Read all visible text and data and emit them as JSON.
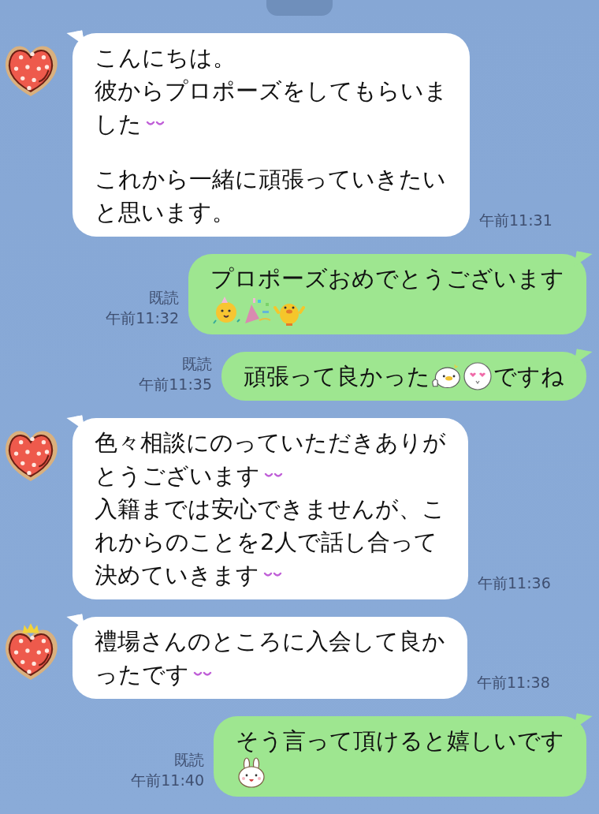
{
  "messages": [
    {
      "kind": "incoming",
      "avatar": {
        "kind": "heart"
      },
      "time": "午前11:31",
      "paragraphs": [
        [
          [
            {
              "kind": "text",
              "text": "こんにちは。"
            }
          ],
          [
            {
              "kind": "text",
              "text": "彼からプロポーズをしてもらいま"
            }
          ],
          [
            {
              "kind": "text",
              "text": "した"
            },
            {
              "kind": "smile"
            }
          ]
        ],
        [
          [
            {
              "kind": "text",
              "text": "これから一緒に頑張っていきたい"
            }
          ],
          [
            {
              "kind": "text",
              "text": "と思います。"
            }
          ]
        ]
      ]
    },
    {
      "kind": "outgoing",
      "read": "既読",
      "time": "午前11:32",
      "paragraphs": [
        [
          [
            {
              "kind": "text",
              "text": "プロポーズおめでとうございます"
            }
          ],
          [
            {
              "kind": "chick"
            },
            {
              "kind": "confetti"
            },
            {
              "kind": "duck"
            }
          ]
        ]
      ]
    },
    {
      "kind": "outgoing",
      "read": "既読",
      "time": "午前11:35",
      "paragraphs": [
        [
          [
            {
              "kind": "text",
              "text": "頑張って良かった"
            },
            {
              "kind": "bird"
            },
            {
              "kind": "love"
            },
            {
              "kind": "text",
              "text": "ですね"
            }
          ]
        ]
      ]
    },
    {
      "kind": "incoming",
      "avatar": {
        "kind": "heart"
      },
      "time": "午前11:36",
      "paragraphs": [
        [
          [
            {
              "kind": "text",
              "text": "色々相談にのっていただきありが"
            }
          ],
          [
            {
              "kind": "text",
              "text": "とうございます"
            },
            {
              "kind": "smile"
            }
          ],
          [
            {
              "kind": "text",
              "text": "入籍までは安心できませんが、こ"
            }
          ],
          [
            {
              "kind": "text",
              "text": "れからのことを2人で話し合って"
            }
          ],
          [
            {
              "kind": "text",
              "text": "決めていきます"
            },
            {
              "kind": "smile"
            }
          ]
        ]
      ]
    },
    {
      "kind": "incoming",
      "avatar": {
        "kind": "heart-crown"
      },
      "time": "午前11:38",
      "paragraphs": [
        [
          [
            {
              "kind": "text",
              "text": "禮場さんのところに入会して良か"
            }
          ],
          [
            {
              "kind": "text",
              "text": "ったです"
            },
            {
              "kind": "smile"
            }
          ]
        ]
      ]
    },
    {
      "kind": "outgoing",
      "read": "既読",
      "time": "午前11:40",
      "paragraphs": [
        [
          [
            {
              "kind": "text",
              "text": "そう言って頂けると嬉しいです"
            }
          ],
          [
            {
              "kind": "bunny"
            }
          ]
        ]
      ]
    }
  ]
}
